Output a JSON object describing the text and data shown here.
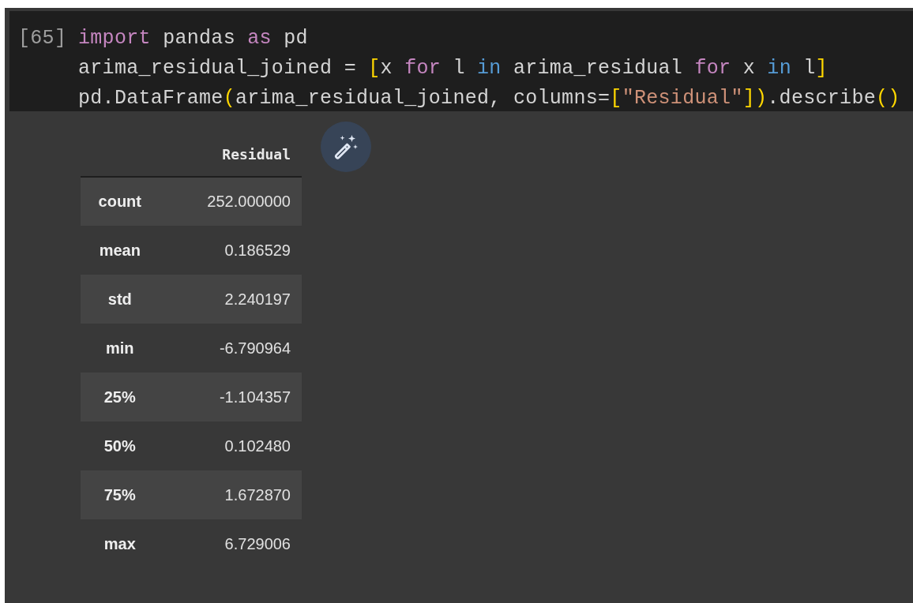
{
  "cell": {
    "execution_count": "[65]",
    "code_lines": [
      [
        {
          "kind": "keyword",
          "text": "import"
        },
        {
          "kind": "plain",
          "text": " pandas "
        },
        {
          "kind": "keyword",
          "text": "as"
        },
        {
          "kind": "plain",
          "text": " pd"
        }
      ],
      [
        {
          "kind": "plain",
          "text": "arima_residual_joined = "
        },
        {
          "kind": "bracket",
          "text": "["
        },
        {
          "kind": "plain",
          "text": "x "
        },
        {
          "kind": "keyword",
          "text": "for"
        },
        {
          "kind": "plain",
          "text": " l "
        },
        {
          "kind": "operator",
          "text": "in"
        },
        {
          "kind": "plain",
          "text": " arima_residual "
        },
        {
          "kind": "keyword",
          "text": "for"
        },
        {
          "kind": "plain",
          "text": " x "
        },
        {
          "kind": "operator",
          "text": "in"
        },
        {
          "kind": "plain",
          "text": " l"
        },
        {
          "kind": "bracket",
          "text": "]"
        }
      ],
      [
        {
          "kind": "plain",
          "text": "pd.DataFrame"
        },
        {
          "kind": "bracket",
          "text": "("
        },
        {
          "kind": "plain",
          "text": "arima_residual_joined, columns="
        },
        {
          "kind": "bracket",
          "text": "["
        },
        {
          "kind": "string",
          "text": "\"Residual\""
        },
        {
          "kind": "bracket",
          "text": "])"
        },
        {
          "kind": "plain",
          "text": ".describe"
        },
        {
          "kind": "bracket",
          "text": "()"
        }
      ]
    ],
    "output": {
      "table": {
        "columns": [
          "Residual"
        ],
        "rows": [
          {
            "label": "count",
            "value": "252.000000"
          },
          {
            "label": "mean",
            "value": "0.186529"
          },
          {
            "label": "std",
            "value": "2.240197"
          },
          {
            "label": "min",
            "value": "-6.790964"
          },
          {
            "label": "25%",
            "value": "-1.104357"
          },
          {
            "label": "50%",
            "value": "0.102480"
          },
          {
            "label": "75%",
            "value": "1.672870"
          },
          {
            "label": "max",
            "value": "6.729006"
          }
        ]
      }
    }
  }
}
